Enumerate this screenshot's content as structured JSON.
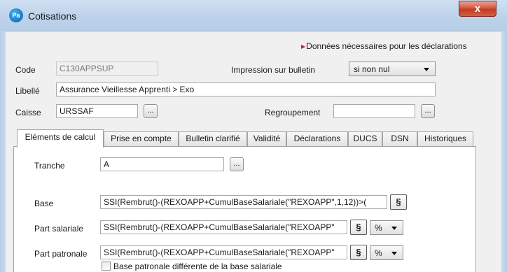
{
  "window": {
    "title": "Cotisations",
    "app_icon_text": "Pa",
    "close_label": "x"
  },
  "hint": {
    "text": "Données nécessaires pour les déclarations"
  },
  "form": {
    "code": {
      "label": "Code",
      "value": "C130APPSUP"
    },
    "impression": {
      "label": "Impression sur bulletin",
      "value": "si non nul"
    },
    "libelle": {
      "label": "Libellé",
      "value": "Assurance Vieillesse Apprenti > Exo"
    },
    "caisse": {
      "label": "Caisse",
      "value": "URSSAF",
      "button": "..."
    },
    "regroupement": {
      "label": "Regroupement",
      "value": "",
      "button": "..."
    }
  },
  "tabs": [
    {
      "label": "Eléments de calcul",
      "active": true
    },
    {
      "label": "Prise en compte"
    },
    {
      "label": "Bulletin clarifié"
    },
    {
      "label": "Validité"
    },
    {
      "label": "Déclarations"
    },
    {
      "label": "DUCS"
    },
    {
      "label": "DSN"
    },
    {
      "label": "Historiques"
    }
  ],
  "calc": {
    "tranche": {
      "label": "Tranche",
      "value": "A",
      "button": "..."
    },
    "base": {
      "label": "Base",
      "value": "SSI(Rembrut()-(REXOAPP+CumulBaseSalariale(\"REXOAPP\",1,12))>(",
      "button": "§"
    },
    "part_salariale": {
      "label": "Part salariale",
      "value": "SSI(Rembrut()-(REXOAPP+CumulBaseSalariale(\"REXOAPP\"",
      "button": "§",
      "unit": "%"
    },
    "part_patronale": {
      "label": "Part patronale",
      "value": "SSI(Rembrut()-(REXOAPP+CumulBaseSalariale(\"REXOAPP\"",
      "button": "§",
      "unit": "%"
    },
    "base_patronale_diff": {
      "label": "Base patronale différente de la base salariale",
      "checked": false
    }
  }
}
